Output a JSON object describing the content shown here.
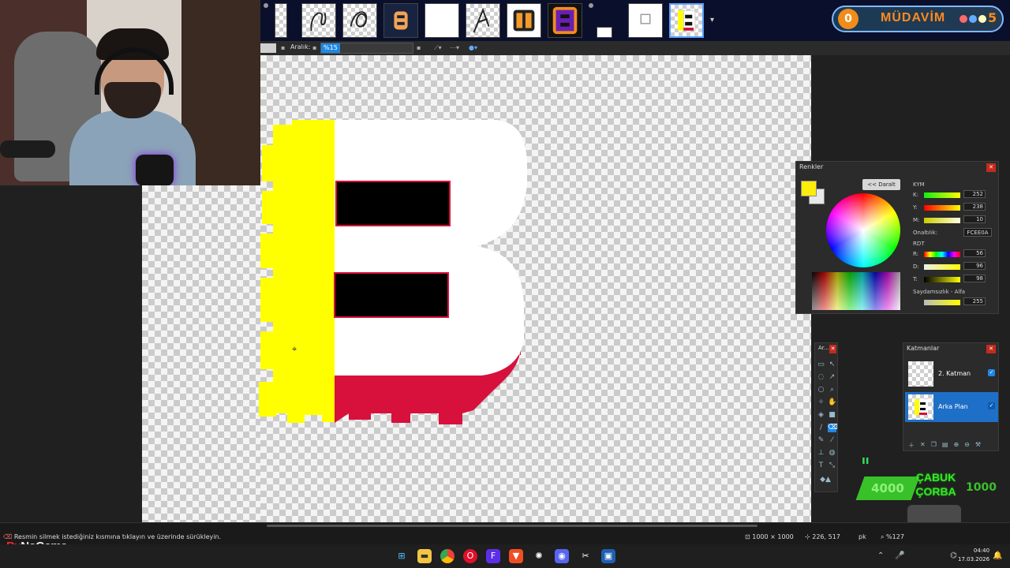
{
  "tabs": [
    {
      "name": "canvas-tab-1"
    },
    {
      "name": "canvas-tab-2"
    },
    {
      "name": "canvas-tab-3"
    },
    {
      "name": "canvas-tab-4"
    },
    {
      "name": "canvas-tab-5"
    },
    {
      "name": "canvas-tab-6"
    },
    {
      "name": "canvas-tab-7"
    },
    {
      "name": "canvas-tab-8"
    },
    {
      "name": "canvas-tab-9"
    },
    {
      "name": "canvas-tab-10"
    },
    {
      "name": "canvas-tab-11"
    }
  ],
  "toolbar": {
    "range_label": "Aralık:",
    "range_value": "%15"
  },
  "badge": {
    "level": "0",
    "title": "MÜDAVİM",
    "count": "5"
  },
  "colors_panel": {
    "title": "Renkler",
    "collapse_label": "<< Daralt",
    "kym_label": "KYM",
    "r_label": "K:",
    "g_label": "Y:",
    "b_label": "M:",
    "r_value": "252",
    "g_value": "238",
    "b_value": "10",
    "hex_label": "Onaltılık:",
    "hex_value": "FCEE0A",
    "rdt_label": "RDT",
    "h_label": "R:",
    "s_label": "D:",
    "v_label": "T:",
    "h_value": "56",
    "s_value": "96",
    "v_value": "98",
    "alpha_label": "Saydamsızlık - Alfa",
    "alpha_value": "255",
    "primary_color": "#fcee0a"
  },
  "tools_panel": {
    "title": "Ar..."
  },
  "layers_panel": {
    "title": "Katmanlar",
    "layers": [
      {
        "name": "2. Katman",
        "visible": true,
        "selected": false
      },
      {
        "name": "Arka Plan",
        "visible": true,
        "selected": true
      }
    ]
  },
  "alert": {
    "left": "4000",
    "mid_line1": "ÇABUK",
    "mid_line2": "ÇORBA",
    "right": "1000"
  },
  "status": {
    "message": "Resmin silmek istediğiniz kısmına tıklayın ve üzerinde sürükleyin.",
    "image_size": "1000 × 1000",
    "cursor_pos": "226, 517",
    "unit": "pk",
    "zoom": "%127"
  },
  "logo": {
    "part1": "By",
    "part2": "NoGame"
  },
  "taskbar": {
    "time": "04:40",
    "date": "17.03.2026"
  }
}
